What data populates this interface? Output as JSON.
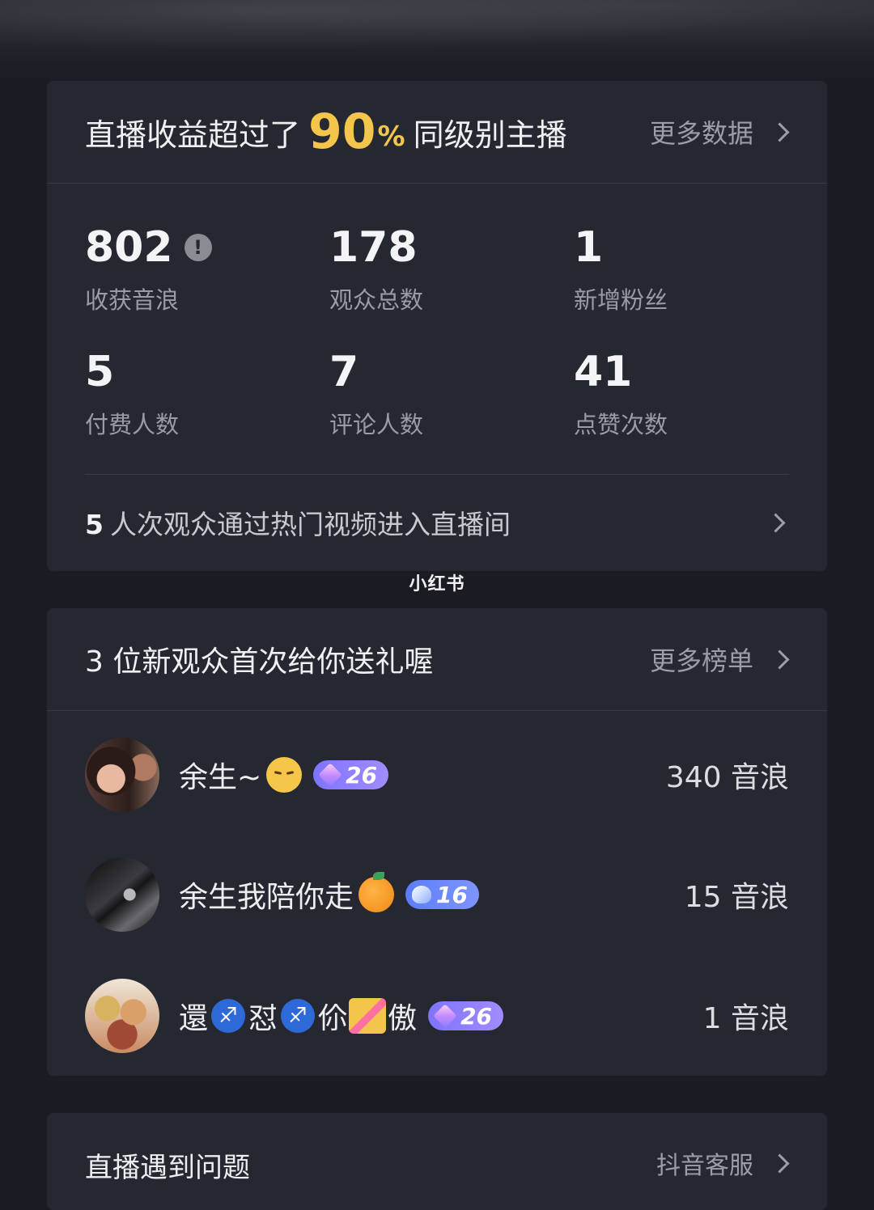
{
  "revenue_card": {
    "title_prefix": "直播收益超过了",
    "percent_value": "90",
    "percent_sign": "%",
    "title_suffix": "同级别主播",
    "more_link": "更多数据",
    "stats": [
      {
        "value": "802",
        "label": "收获音浪",
        "has_info_icon": true
      },
      {
        "value": "178",
        "label": "观众总数"
      },
      {
        "value": "1",
        "label": "新增粉丝"
      },
      {
        "value": "5",
        "label": "付费人数"
      },
      {
        "value": "7",
        "label": "评论人数"
      },
      {
        "value": "41",
        "label": "点赞次数"
      }
    ],
    "hot_video_count": "5",
    "hot_video_text": "人次观众通过热门视频进入直播间"
  },
  "watermark": "小红书",
  "gift_card": {
    "title": "3 位新观众首次给你送礼喔",
    "more_link": "更多榜单",
    "rows": [
      {
        "name": "余生~",
        "emoji": "pensive-face",
        "level": "26",
        "badge_color": "#8f7bff",
        "amount": "340 音浪"
      },
      {
        "name": "余生我陪你走",
        "emoji": "tangerine",
        "level": "16",
        "badge_color": "#6a86ff",
        "amount": "15 音浪"
      },
      {
        "name_parts": [
          "還",
          "怼",
          "伱",
          "傲"
        ],
        "emoji": "sagittarius-couple",
        "level": "26",
        "badge_color": "#8f7bff",
        "amount": "1 音浪"
      }
    ]
  },
  "issue_card": {
    "title": "直播遇到问题",
    "more_link": "抖音客服"
  },
  "colors": {
    "background": "#1b1c23",
    "card": "#262831",
    "accent": "#f4c54b",
    "muted_text": "#9a9ba4"
  }
}
